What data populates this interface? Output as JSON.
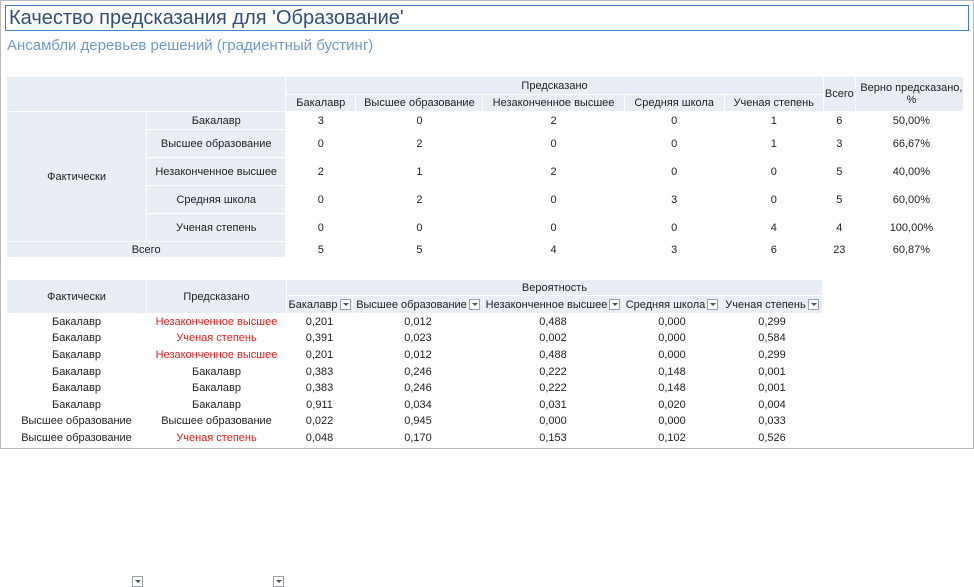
{
  "title": "Качество предсказания для 'Образование'",
  "subtitle": "Ансамбли деревьев решений (градиентный бустинг)",
  "confusion": {
    "predicted_header": "Предсказано",
    "actual_header": "Фактически",
    "total_label": "Всего",
    "accuracy_label": "Верно предсказано, %",
    "classes": [
      "Бакалавр",
      "Высшее образование",
      "Незаконченное высшее",
      "Средняя школа",
      "Ученая степень"
    ],
    "rows": [
      {
        "label": "Бакалавр",
        "values": [
          "3",
          "0",
          "2",
          "0",
          "1"
        ],
        "total": "6",
        "pct": "50,00%"
      },
      {
        "label": "Высшее образование",
        "values": [
          "0",
          "2",
          "0",
          "0",
          "1"
        ],
        "total": "3",
        "pct": "66,67%"
      },
      {
        "label": "Незаконченное высшее",
        "values": [
          "2",
          "1",
          "2",
          "0",
          "0"
        ],
        "total": "5",
        "pct": "40,00%"
      },
      {
        "label": "Средняя школа",
        "values": [
          "0",
          "2",
          "0",
          "3",
          "0"
        ],
        "total": "5",
        "pct": "60,00%"
      },
      {
        "label": "Ученая степень",
        "values": [
          "0",
          "0",
          "0",
          "0",
          "4"
        ],
        "total": "4",
        "pct": "100,00%"
      }
    ],
    "totals": {
      "values": [
        "5",
        "5",
        "4",
        "3",
        "6"
      ],
      "total": "23",
      "pct": "60,87%"
    }
  },
  "predictions": {
    "col_actual": "Фактически",
    "col_predicted": "Предсказано",
    "col_probability": "Вероятность",
    "prob_columns": [
      "Бакалавр",
      "Высшее образование",
      "Незаконченное высшее",
      "Средняя школа",
      "Ученая степень"
    ],
    "rows": [
      {
        "actual": "Бакалавр",
        "predicted": "Незаконченное высшее",
        "wrong": true,
        "p": [
          "0,201",
          "0,012",
          "0,488",
          "0,000",
          "0,299"
        ]
      },
      {
        "actual": "Бакалавр",
        "predicted": "Ученая степень",
        "wrong": true,
        "p": [
          "0,391",
          "0,023",
          "0,002",
          "0,000",
          "0,584"
        ]
      },
      {
        "actual": "Бакалавр",
        "predicted": "Незаконченное высшее",
        "wrong": true,
        "p": [
          "0,201",
          "0,012",
          "0,488",
          "0,000",
          "0,299"
        ]
      },
      {
        "actual": "Бакалавр",
        "predicted": "Бакалавр",
        "wrong": false,
        "p": [
          "0,383",
          "0,246",
          "0,222",
          "0,148",
          "0,001"
        ]
      },
      {
        "actual": "Бакалавр",
        "predicted": "Бакалавр",
        "wrong": false,
        "p": [
          "0,383",
          "0,246",
          "0,222",
          "0,148",
          "0,001"
        ]
      },
      {
        "actual": "Бакалавр",
        "predicted": "Бакалавр",
        "wrong": false,
        "p": [
          "0,911",
          "0,034",
          "0,031",
          "0,020",
          "0,004"
        ]
      },
      {
        "actual": "Высшее образование",
        "predicted": "Высшее образование",
        "wrong": false,
        "p": [
          "0,022",
          "0,945",
          "0,000",
          "0,000",
          "0,033"
        ]
      },
      {
        "actual": "Высшее образование",
        "predicted": "Ученая степень",
        "wrong": true,
        "p": [
          "0,048",
          "0,170",
          "0,153",
          "0,102",
          "0,526"
        ]
      }
    ]
  },
  "colors": {
    "accent": "#3c7fc4",
    "header_bg": "#e9edf4",
    "error_text": "#e02020"
  }
}
